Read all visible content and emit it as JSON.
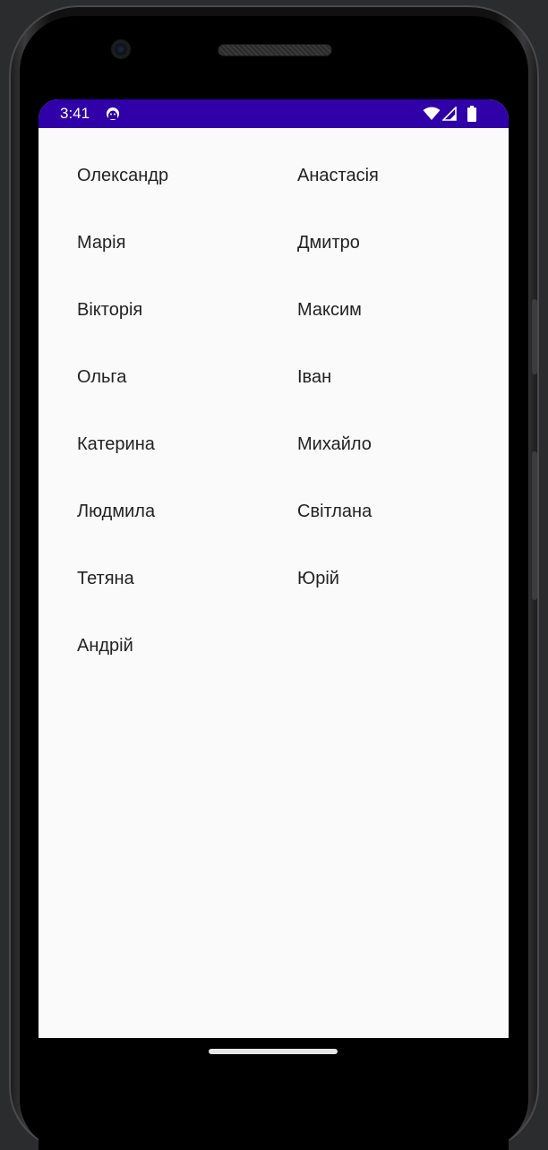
{
  "status_bar": {
    "time": "3:41",
    "app_icon": "android-debug-icon",
    "icons": [
      "wifi-icon",
      "cellular-signal-icon",
      "battery-icon"
    ],
    "background_color": "#3000a8"
  },
  "names": {
    "left_column": [
      "Олександр",
      "Марія",
      "Вікторія",
      "Ольга",
      "Катерина",
      "Людмила",
      "Тетяна",
      "Андрій"
    ],
    "right_column": [
      "Анастасія",
      "Дмитро",
      "Максим",
      "Іван",
      "Михайло",
      "Світлана",
      "Юрій"
    ]
  },
  "colors": {
    "screen_background": "#fafafa",
    "text": "#222222"
  }
}
